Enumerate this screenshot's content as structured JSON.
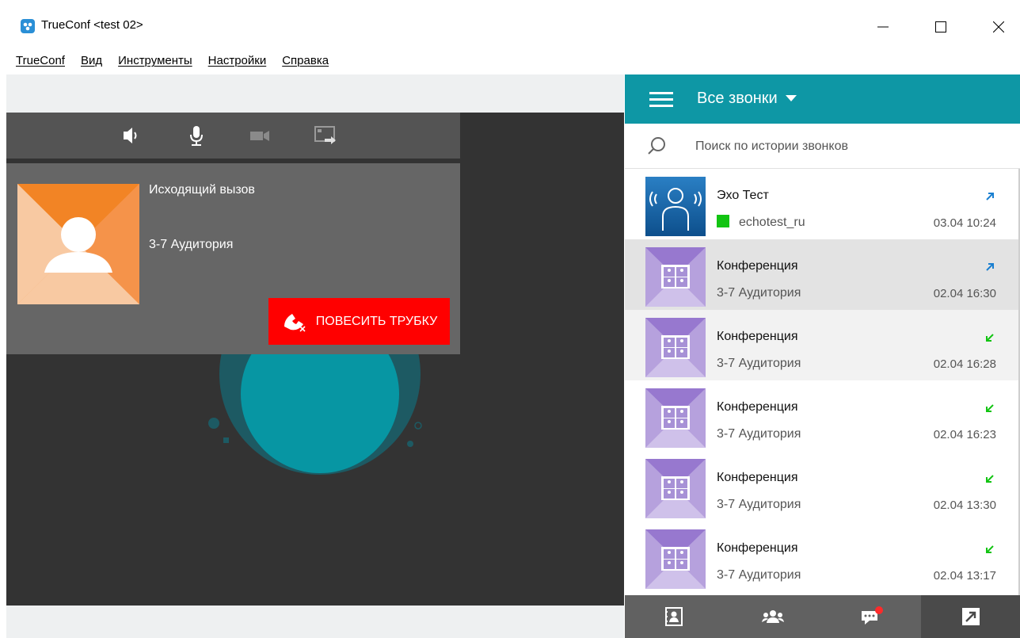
{
  "window": {
    "title": "TrueConf <test 02>",
    "controls": [
      "minimize-icon",
      "maximize-icon",
      "close-icon"
    ]
  },
  "menu": [
    "TrueConf",
    "Вид",
    "Инструменты",
    "Настройки",
    "Справка"
  ],
  "call_controls": [
    "speaker-icon",
    "microphone-icon",
    "camera-icon",
    "screen-share-icon"
  ],
  "active_call": {
    "status": "Исходящий вызов",
    "name": "3-7 Аудитория",
    "hangup_label": "ПОВЕСИТЬ ТРУБКУ"
  },
  "panel": {
    "filter_label": "Все звонки",
    "search_placeholder": "Поиск по истории звонков"
  },
  "calls": [
    {
      "title": "Эхо Тест",
      "subtitle": "echotest_ru",
      "time": "03.04 10:24",
      "direction": "outgoing",
      "type": "echo",
      "online": true
    },
    {
      "title": "Конференция",
      "subtitle": "3-7 Аудитория",
      "time": "02.04 16:30",
      "direction": "outgoing",
      "type": "conference"
    },
    {
      "title": "Конференция",
      "subtitle": "3-7 Аудитория",
      "time": "02.04 16:28",
      "direction": "incoming",
      "type": "conference"
    },
    {
      "title": "Конференция",
      "subtitle": "3-7 Аудитория",
      "time": "02.04 16:23",
      "direction": "incoming",
      "type": "conference"
    },
    {
      "title": "Конференция",
      "subtitle": "3-7 Аудитория",
      "time": "02.04 13:30",
      "direction": "incoming",
      "type": "conference"
    },
    {
      "title": "Конференция",
      "subtitle": "3-7 Аудитория",
      "time": "02.04 13:17",
      "direction": "incoming",
      "type": "conference"
    }
  ],
  "bottom_nav": [
    "contacts-icon",
    "conferences-icon",
    "chat-icon",
    "call-history-icon"
  ],
  "colors": {
    "accent": "#0e97a5",
    "hangup": "#ff0000",
    "presence_online": "#12c412",
    "outgoing_arrow": "#1a7fd0",
    "incoming_arrow": "#12c412",
    "notification": "#ff2a2a"
  }
}
